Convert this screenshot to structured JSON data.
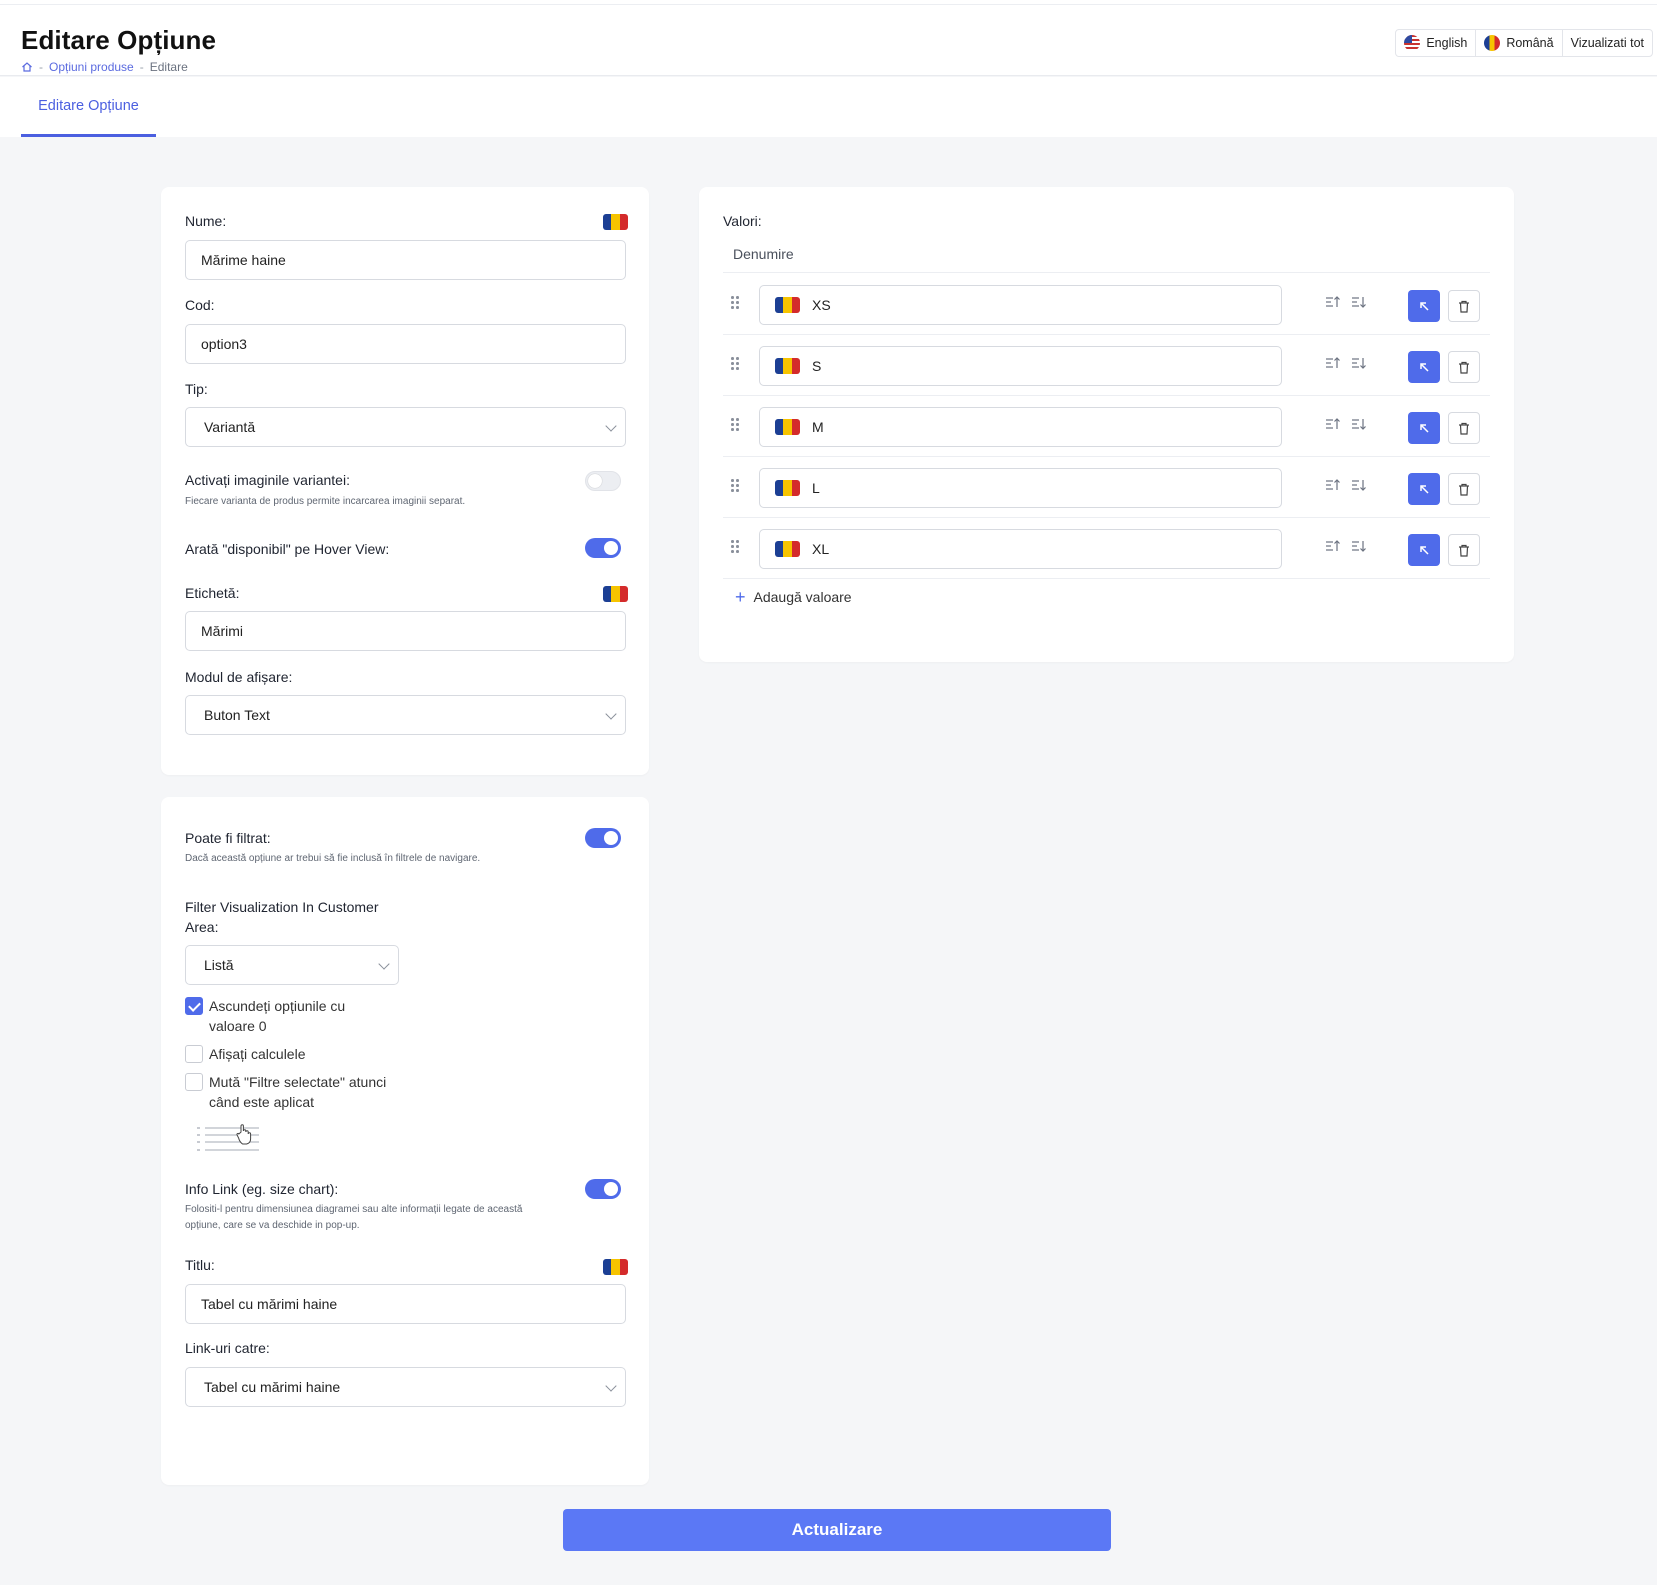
{
  "header": {
    "title": "Editare Opțiune",
    "breadcrumb": {
      "parent": "Opțiuni produse",
      "current": "Editare"
    },
    "languages": {
      "english": "English",
      "romana": "Română",
      "view_all": "Vizualizati tot"
    }
  },
  "tabs": {
    "active": "Editare Opțiune"
  },
  "form": {
    "nume_label": "Nume:",
    "nume_value": "Mărime haine",
    "cod_label": "Cod:",
    "cod_value": "option3",
    "tip_label": "Tip:",
    "tip_value": "Variantă",
    "activ_img_label": "Activați imaginile variantei:",
    "activ_img_help": "Fiecare varianta de produs permite incarcarea imaginii separat.",
    "activ_img_on": false,
    "hover_label": "Arată \"disponibil\" pe Hover View:",
    "hover_on": true,
    "eticheta_label": "Etichetă:",
    "eticheta_value": "Mărimi",
    "modul_label": "Modul de afișare:",
    "modul_value": "Buton Text",
    "filtrat_label": "Poate fi filtrat:",
    "filtrat_help": "Dacă această opțiune ar trebui să fie inclusă în filtrele de navigare.",
    "filtrat_on": true,
    "filter_vis_label": "Filter Visualization In Customer Area:",
    "filter_vis_value": "Listă",
    "chk_hide_label": "Ascundeți opțiunile cu valoare 0",
    "chk_hide_checked": true,
    "chk_calc_label": "Afișați calculele",
    "chk_calc_checked": false,
    "chk_move_label": "Mută \"Filtre selectate\" atunci când este aplicat",
    "chk_move_checked": false,
    "info_label": "Info Link (eg. size chart):",
    "info_help": "Folositi-l pentru dimensiunea diagramei sau alte informații legate de această opțiune, care se va deschide in pop-up.",
    "info_on": true,
    "titlu_label": "Titlu:",
    "titlu_value": "Tabel cu mărimi haine",
    "link_label": "Link-uri catre:",
    "link_value": "Tabel cu mărimi haine"
  },
  "valori": {
    "label": "Valori:",
    "column": "Denumire",
    "items": [
      "XS",
      "S",
      "M",
      "L",
      "XL"
    ],
    "add_label": "Adaugă valoare"
  },
  "submit_label": "Actualizare",
  "colors": {
    "accent": "#4f6bea",
    "button": "#5b78f5"
  },
  "icons": [
    "home-icon",
    "us-flag-icon",
    "ro-flag-icon",
    "drag-handle-icon",
    "sort-asc-icon",
    "sort-desc-icon",
    "select-arrow-icon",
    "trash-icon",
    "plus-icon",
    "chevron-down-icon"
  ]
}
